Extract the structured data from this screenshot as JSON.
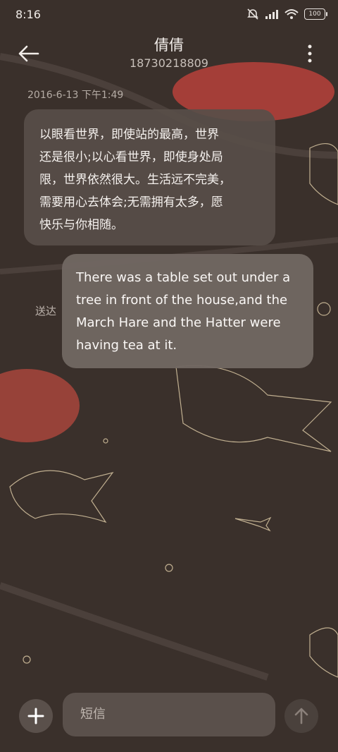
{
  "status_bar": {
    "time": "8:16",
    "battery": "100",
    "icons": [
      "mute-icon",
      "signal-icon",
      "wifi-icon",
      "battery-icon"
    ]
  },
  "header": {
    "contact_name": "倩倩",
    "contact_number": "18730218809",
    "icons": [
      "back-arrow-icon",
      "more-vertical-icon"
    ]
  },
  "messages": {
    "timestamp": "2016-6-13 下午1:49",
    "incoming": {
      "lines": [
        "以眼看世界，即使站的最高，世界",
        "还是很小;以心看世界，即使身处局",
        "限，世界依然很大。生活远不完美，",
        "需要用心去体会;无需拥有太多，愿",
        "快乐与你相随。"
      ]
    },
    "outgoing": {
      "lines": [
        "There was a table set out under a",
        "tree in front of the house,and the",
        "March Hare and the Hatter were",
        "having tea at it."
      ],
      "status": "送达"
    }
  },
  "composer": {
    "placeholder": "短信",
    "icons": [
      "plus-icon",
      "send-arrow-icon"
    ]
  },
  "colors": {
    "background": "#3a302b",
    "incoming_bubble": "#584e49",
    "outgoing_bubble": "#706762",
    "accent_red": "#b0403a",
    "sketch_line": "#d8c6a2"
  }
}
